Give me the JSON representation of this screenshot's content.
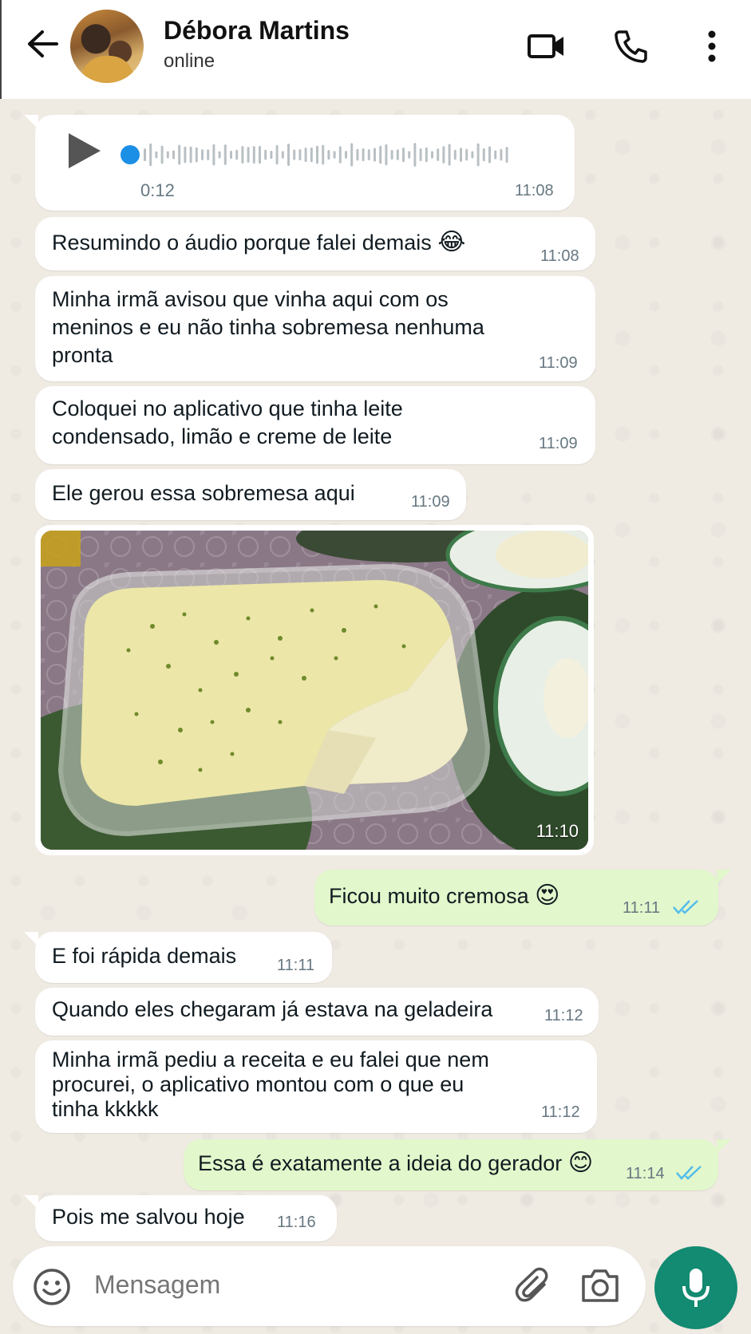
{
  "header": {
    "contact_name": "Débora Martins",
    "status": "online",
    "icons": [
      "back-arrow-icon",
      "video-call-icon",
      "phone-icon",
      "more-vert-icon"
    ]
  },
  "messages": {
    "voice": {
      "duration": "0:12",
      "time": "11:08"
    },
    "m1": {
      "text": "Resumindo o áudio porque falei demais",
      "emoji": "😂",
      "time": "11:08"
    },
    "m2": {
      "line1": "Minha irmã avisou que vinha aqui com os",
      "line2": "meninos e eu não tinha sobremesa nenhuma",
      "line3": "pronta",
      "time": "11:09"
    },
    "m3": {
      "line1": "Coloquei no aplicativo que tinha leite",
      "line2": "condensado, limão e creme de leite",
      "time": "11:09"
    },
    "m4": {
      "text": "Ele gerou essa sobremesa aqui",
      "time": "11:09"
    },
    "photo": {
      "time": "11:10"
    },
    "o1": {
      "text": "Ficou muito cremosa",
      "emoji": "😍",
      "time": "11:11"
    },
    "m5": {
      "text": "E foi rápida demais",
      "time": "11:11"
    },
    "m6": {
      "text": "Quando eles chegaram já estava na geladeira",
      "time": "11:12"
    },
    "m7": {
      "line1": "Minha irmã pediu a receita e eu falei que nem",
      "line2": "procurei, o aplicativo montou com o que eu",
      "line3": "tinha kkkkk",
      "time": "11:12"
    },
    "o2": {
      "text": "Essa é exatamente a ideia do gerador",
      "emoji": "😊",
      "time": "11:14"
    },
    "m8": {
      "text": "Pois me salvou hoje",
      "time": "11:16"
    }
  },
  "composer": {
    "placeholder": "Mensagem",
    "icons": [
      "emoji-icon",
      "attach-icon",
      "camera-icon",
      "mic-icon"
    ]
  },
  "colors": {
    "wallpaper": "#efeae2",
    "incoming": "#ffffff",
    "outgoing": "#e2f7cb",
    "read_ticks": "#53bdeb",
    "mic_button": "#138a72"
  }
}
